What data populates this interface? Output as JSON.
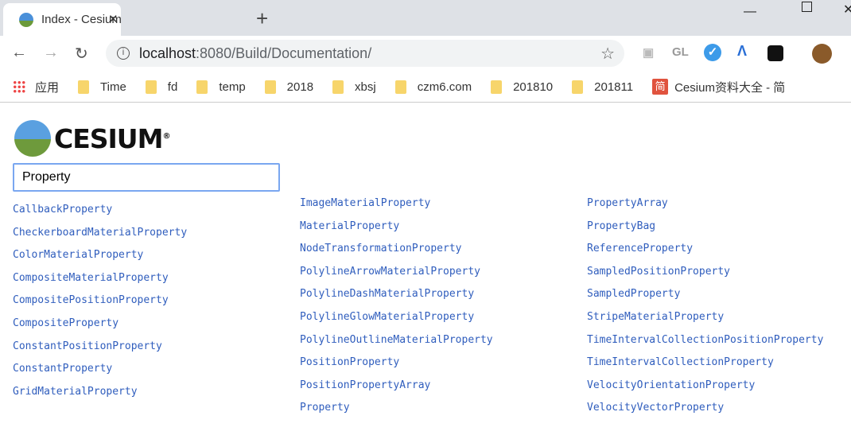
{
  "browser": {
    "tab_title": "Index - Cesium Documentation",
    "url_host": "localhost",
    "url_path": ":8080/Build/Documentation/",
    "extensions": [
      "GL"
    ],
    "bookmarks": [
      {
        "label": "应用",
        "icon": "apps-icon"
      },
      {
        "label": "Time"
      },
      {
        "label": "fd"
      },
      {
        "label": "temp"
      },
      {
        "label": "2018"
      },
      {
        "label": "xbsj"
      },
      {
        "label": "czm6.com"
      },
      {
        "label": "201810"
      },
      {
        "label": "201811"
      },
      {
        "label": "Cesium资料大全 - 简",
        "icon": "jian-icon",
        "icon_text": "简"
      }
    ]
  },
  "page": {
    "logo_text": "CESIUM",
    "logo_mark": "®",
    "search_value": "Property",
    "columns": [
      [
        "CallbackProperty",
        "CheckerboardMaterialProperty",
        "ColorMaterialProperty",
        "CompositeMaterialProperty",
        "CompositePositionProperty",
        "CompositeProperty",
        "ConstantPositionProperty",
        "ConstantProperty",
        "GridMaterialProperty"
      ],
      [
        "ImageMaterialProperty",
        "MaterialProperty",
        "NodeTransformationProperty",
        "PolylineArrowMaterialProperty",
        "PolylineDashMaterialProperty",
        "PolylineGlowMaterialProperty",
        "PolylineOutlineMaterialProperty",
        "PositionProperty",
        "PositionPropertyArray",
        "Property"
      ],
      [
        "PropertyArray",
        "PropertyBag",
        "ReferenceProperty",
        "SampledPositionProperty",
        "SampledProperty",
        "StripeMaterialProperty",
        "TimeIntervalCollectionPositionProperty",
        "TimeIntervalCollectionProperty",
        "VelocityOrientationProperty",
        "VelocityVectorProperty"
      ]
    ]
  }
}
